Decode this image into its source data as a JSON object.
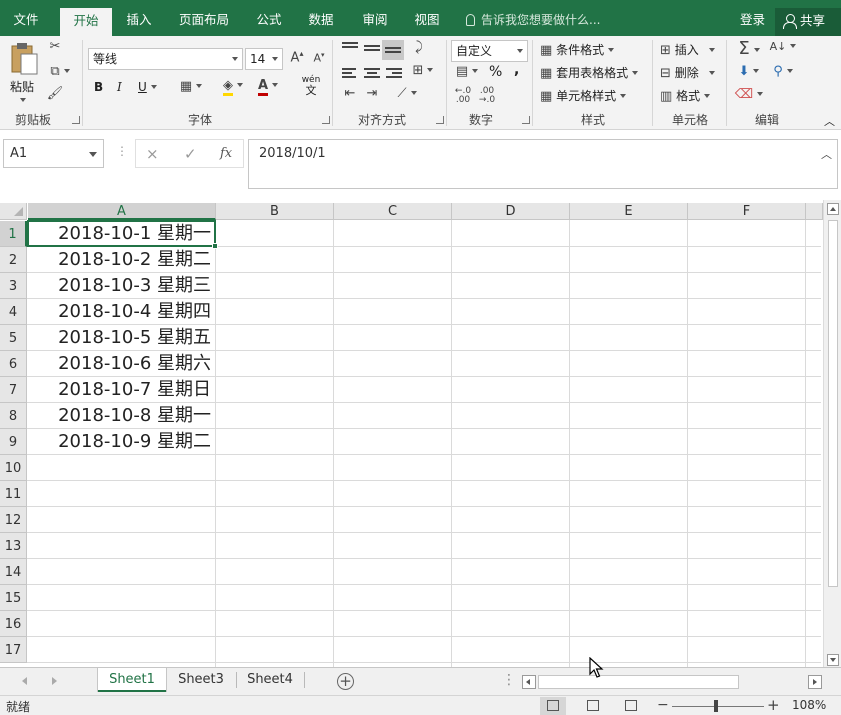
{
  "ribbon_tabs": [
    {
      "label": "文件"
    },
    {
      "label": "开始"
    },
    {
      "label": "插入"
    },
    {
      "label": "页面布局"
    },
    {
      "label": "公式"
    },
    {
      "label": "数据"
    },
    {
      "label": "审阅"
    },
    {
      "label": "视图"
    }
  ],
  "active_tab": "开始",
  "tell_me": "告诉我您想要做什么...",
  "login": "登录",
  "share": "共享",
  "clipboard": {
    "paste": "粘贴",
    "group": "剪贴板"
  },
  "font": {
    "name": "等线",
    "size": "14",
    "group": "字体",
    "bold": "B",
    "italic": "I",
    "underline": "U",
    "wen": "wén",
    "wen_char": "文"
  },
  "alignment": {
    "group": "对齐方式"
  },
  "number": {
    "format": "自定义",
    "group": "数字",
    "percent": "%",
    "comma": ","
  },
  "styles": {
    "conditional": "条件格式",
    "table": "套用表格格式",
    "cell": "单元格样式",
    "group": "样式"
  },
  "cells": {
    "insert": "插入",
    "delete": "删除",
    "format": "格式",
    "group": "单元格"
  },
  "editing": {
    "group": "编辑"
  },
  "formula_bar": {
    "name_box": "A1",
    "cancel": "×",
    "enter": "✓",
    "fx": "fx",
    "content": "2018/10/1"
  },
  "columns": [
    "A",
    "B",
    "C",
    "D",
    "E",
    "F"
  ],
  "rows": [
    "1",
    "2",
    "3",
    "4",
    "5",
    "6",
    "7",
    "8",
    "9",
    "10",
    "11",
    "12",
    "13",
    "14",
    "15",
    "16",
    "17"
  ],
  "cells_a": [
    "2018-10-1 星期一",
    "2018-10-2 星期二",
    "2018-10-3 星期三",
    "2018-10-4 星期四",
    "2018-10-5 星期五",
    "2018-10-6 星期六",
    "2018-10-7 星期日",
    "2018-10-8 星期一",
    "2018-10-9 星期二"
  ],
  "sheets": [
    "Sheet1",
    "Sheet3",
    "Sheet4"
  ],
  "active_sheet": "Sheet1",
  "add_sheet": "+",
  "status": {
    "ready": "就绪",
    "zoom": "108%",
    "zoom_minus": "−",
    "zoom_plus": "+"
  },
  "colors": {
    "accent": "#217346",
    "ribbon_bg": "#f3f3f3",
    "header_bg": "#e6e6e6",
    "gridline": "#dadada"
  },
  "icons": [
    "cut-icon",
    "copy-icon",
    "format-painter-icon",
    "fill-color-icon",
    "font-color-icon",
    "sum-icon",
    "sort-icon",
    "find-icon",
    "clear-icon",
    "fill-icon"
  ]
}
